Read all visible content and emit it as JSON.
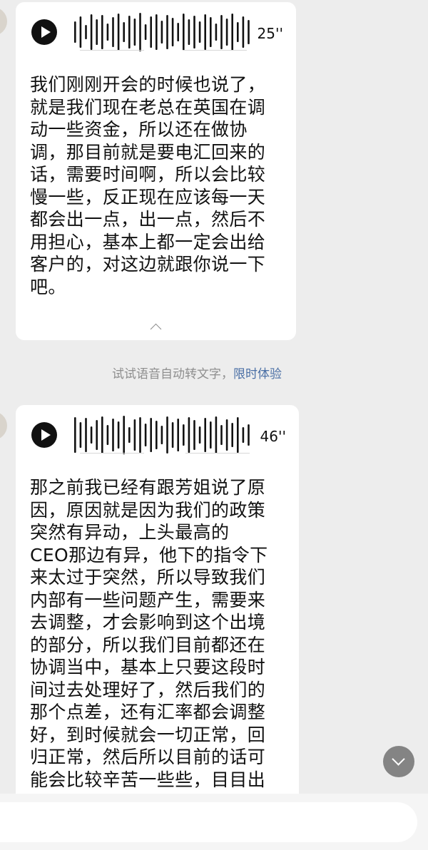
{
  "messages": [
    {
      "duration": "25''",
      "transcript": "我们刚刚开会的时候也说了，\n就是我们现在老总在英国在调\n动一些资金，所以还在做协\n调，那目前就是要电汇回来的\n话，需要时间啊，所以会比较\n慢一些，反正现在应该每一天\n都会出一点，出一点，然后不\n用担心，基本上都一定会出给\n客户的，对这边就跟你说一下\n吧。",
      "collapse_icon": "chevron-up-icon"
    },
    {
      "duration": "46''",
      "transcript": "那之前我已经有跟芳姐说了原\n因，原因就是因为我们的政策\n突然有异动，上头最高的\nCEO那边有异，他下的指令下\n来太过于突然，所以导致我们\n内部有一些问题产生，需要来\n去调整，才会影响到这个出境\n的部分，所以我们目前都还在\n协调当中，基本上只要这段时\n间过去处理好了，然后我们的\n那个点差，还有汇率都会调整\n好，到时候就会一切正常，回\n归正常，然后所以目前的话可\n能会比较辛苦一些些，目目出"
    }
  ],
  "hint": {
    "text": "试试语音自动转文字，",
    "link": "限时体验"
  },
  "icons": {
    "play": "play-icon",
    "scroll_down": "chevron-down-icon"
  },
  "colors": {
    "background": "#ededed",
    "bubble": "#ffffff",
    "link": "#4a6fa5"
  }
}
